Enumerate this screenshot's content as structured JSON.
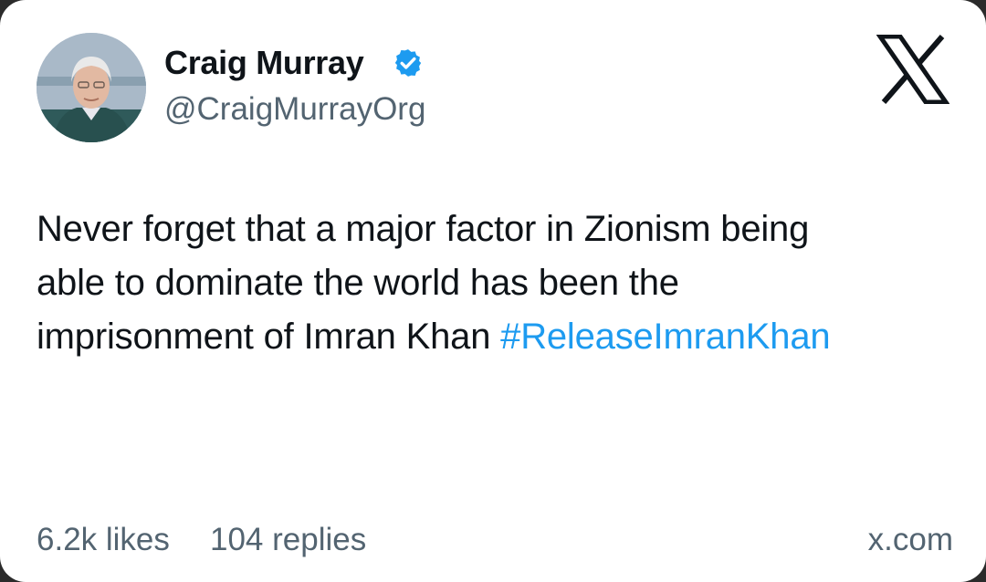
{
  "author": {
    "name": "Craig Murray",
    "handle": "@CraigMurrayOrg",
    "verified_icon": "verified-badge-icon",
    "avatar_icon": "profile-photo"
  },
  "platform_logo": "x-logo-icon",
  "tweet": {
    "text_line1": "Never forget that a major factor in Zionism being",
    "text_line2": "able to dominate the world has been the",
    "text_line3": "imprisonment of Imran Khan ",
    "hashtag": "#ReleaseImranKhan"
  },
  "stats": {
    "likes": "6.2k likes",
    "replies": "104 replies"
  },
  "source": "x.com",
  "colors": {
    "hashtag": "#1d9bf0",
    "verified": "#1d9bf0",
    "text": "#0f1419",
    "secondary": "#536471"
  }
}
